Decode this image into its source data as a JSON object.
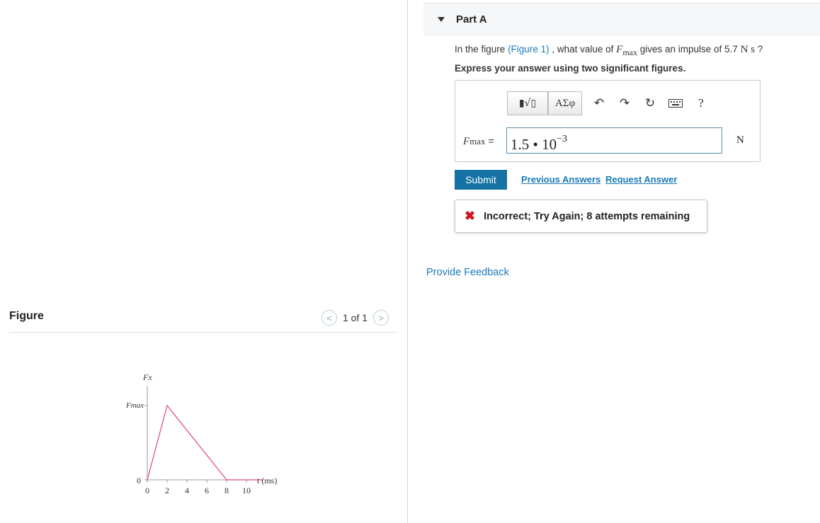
{
  "figure_panel": {
    "title": "Figure",
    "pager_text": "1 of 1",
    "graph": {
      "y_axis_label": "Fx",
      "y_tick_max_label": "Fmax",
      "y_tick_zero_label": "0",
      "x_axis_label": "t (ms)",
      "x_tick_labels": [
        "0",
        "2",
        "4",
        "6",
        "8",
        "10"
      ],
      "line_color": "#e0457b"
    }
  },
  "part": {
    "title": "Part A",
    "question_prefix": "In the figure ",
    "figure_link": "(Figure 1)",
    "question_mid": " , what value of ",
    "question_var": "F",
    "question_var_sub": "max",
    "question_mid2": " gives an impulse of 5.7 ",
    "question_unit": "N s",
    "question_suffix": " ?",
    "instruction": "Express your answer using two significant figures."
  },
  "toolbar": {
    "templates_label": "▮√▯",
    "greek_label": "ΑΣφ",
    "help_label": "?"
  },
  "answer": {
    "var_label": "F",
    "var_sub": "max",
    "equals": " =",
    "input_base": "1.5 • 10",
    "input_exponent": "−3",
    "unit": "N"
  },
  "actions": {
    "submit_label": "Submit",
    "previous_answers": "Previous Answers",
    "request_answer": "Request Answer"
  },
  "feedback": {
    "icon": "✖",
    "text": "Incorrect; Try Again; 8 attempts remaining"
  },
  "provide_feedback": "Provide Feedback",
  "accent_color": "#1572a3",
  "error_color": "#d0121c"
}
